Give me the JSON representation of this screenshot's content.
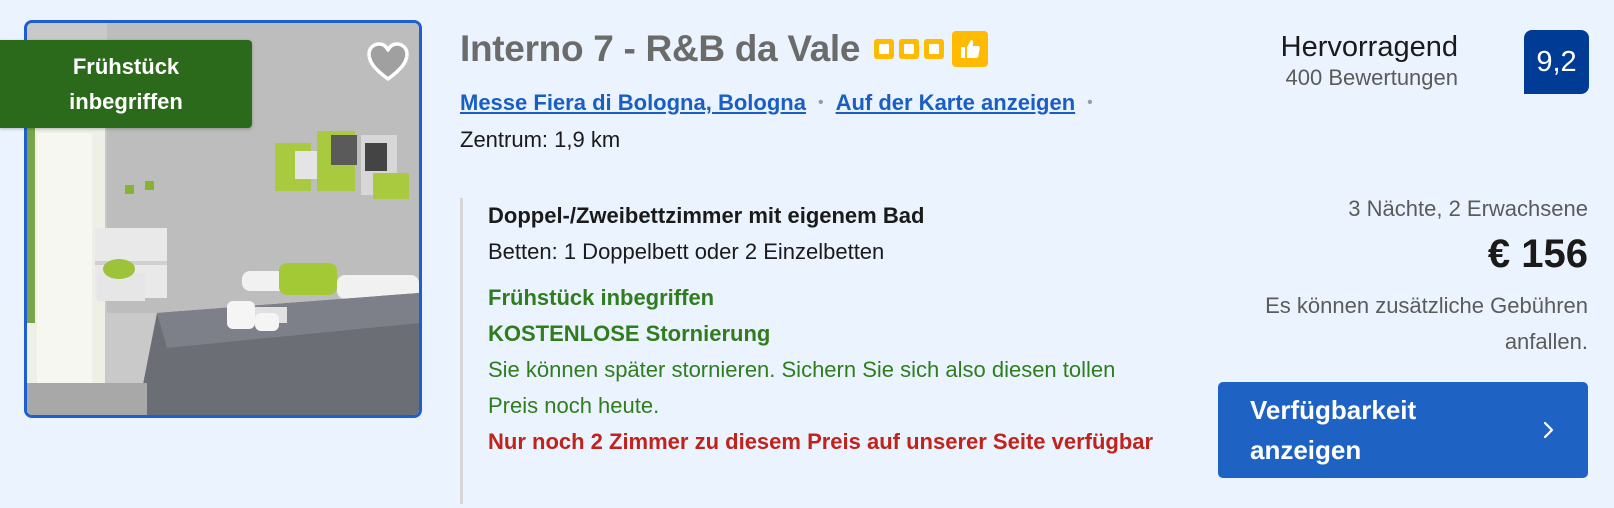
{
  "photo": {
    "badge_text": "Frühstück inbegriffen",
    "favorite_icon": "heart-icon"
  },
  "hotel": {
    "name": "Interno 7 - R&B da Vale",
    "star_count": 3,
    "star_color": "#febb02",
    "thumb_icon": "thumbs-up-icon"
  },
  "location": {
    "area_link": "Messe Fiera di Bologna, Bologna",
    "map_link": "Auf der Karte anzeigen",
    "distance": "Zentrum: 1,9 km"
  },
  "room": {
    "name": "Doppel-/Zweibettzimmer mit eigenem Bad",
    "beds": "Betten: 1 Doppelbett oder 2 Einzelbetten",
    "breakfast": "Frühstück inbegriffen",
    "cancellation": "KOSTENLOSE Stornierung",
    "cancellation_note": "Sie können später stornieren. Sichern Sie sich also diesen tollen Preis noch heute.",
    "scarcity": "Nur noch 2 Zimmer zu diesem Preis auf unserer Seite verfügbar"
  },
  "review": {
    "label": "Hervorragend",
    "count": "400 Bewertungen",
    "score": "9,2",
    "score_color": "#003b95"
  },
  "pricing": {
    "stay": "3 Nächte, 2 Erwachsene",
    "price": "€ 156",
    "fees_note": "Es können zusätzliche Gebühren anfallen."
  },
  "cta": {
    "label": "Verfügbarkeit anzeigen",
    "icon": "chevron-right-icon",
    "color": "#1e63c4"
  }
}
